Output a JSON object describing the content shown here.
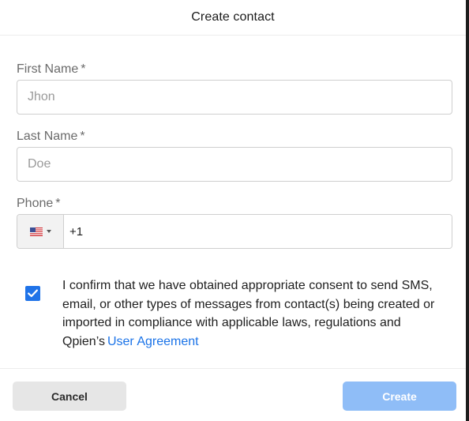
{
  "dialog": {
    "title": "Create contact"
  },
  "form": {
    "first_name": {
      "label": "First Name",
      "required_mark": "*",
      "placeholder": "Jhon",
      "value": ""
    },
    "last_name": {
      "label": "Last Name",
      "required_mark": "*",
      "placeholder": "Doe",
      "value": ""
    },
    "phone": {
      "label": "Phone",
      "required_mark": "*",
      "country_icon": "us-flag-icon",
      "value": "+1"
    }
  },
  "consent": {
    "checked": true,
    "text": "I confirm that we have obtained appropriate consent to send SMS, email, or other types of messages from contact(s) being created or imported in compliance with applicable laws, regulations and Qpien’s",
    "link_label": "User Agreement"
  },
  "actions": {
    "cancel_label": "Cancel",
    "create_label": "Create"
  },
  "colors": {
    "primary": "#1f73e8",
    "create_disabled": "#8fbdf7",
    "cancel_bg": "#e6e6e6",
    "link": "#1a73e8"
  }
}
